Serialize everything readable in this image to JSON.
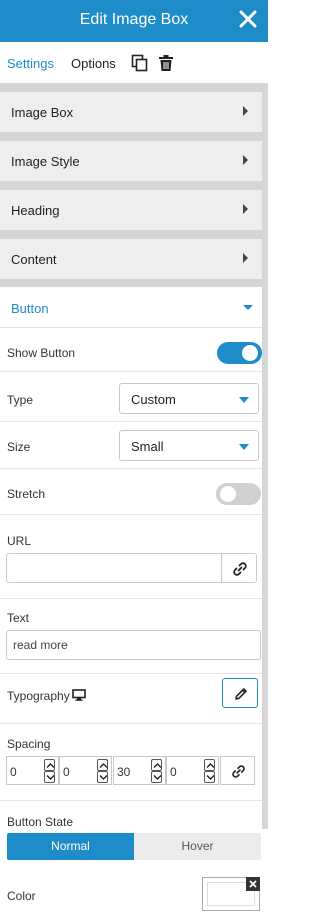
{
  "header": {
    "title": "Edit Image Box"
  },
  "tabs": {
    "settings": "Settings",
    "options": "Options"
  },
  "sections": [
    {
      "label": "Image Box"
    },
    {
      "label": "Image Style"
    },
    {
      "label": "Heading"
    },
    {
      "label": "Content"
    }
  ],
  "button_section": {
    "label": "Button",
    "show_button": {
      "label": "Show Button",
      "on": true
    },
    "type": {
      "label": "Type",
      "value": "Custom"
    },
    "size": {
      "label": "Size",
      "value": "Small"
    },
    "stretch": {
      "label": "Stretch",
      "on": false
    },
    "url": {
      "label": "URL",
      "value": ""
    },
    "text": {
      "label": "Text",
      "value": "read more"
    },
    "typography": {
      "label": "Typography"
    },
    "spacing": {
      "label": "Spacing",
      "values": [
        "0",
        "0",
        "30",
        "0"
      ]
    },
    "button_state": {
      "label": "Button State",
      "normal": "Normal",
      "hover": "Hover"
    },
    "color": {
      "label": "Color"
    }
  },
  "colors": {
    "accent": "#1e8cc9"
  },
  "icons": [
    "close-icon",
    "duplicate-icon",
    "trash-icon",
    "link-icon",
    "desktop-icon",
    "pencil-icon",
    "chevron-up-icon",
    "chevron-down-icon"
  ]
}
